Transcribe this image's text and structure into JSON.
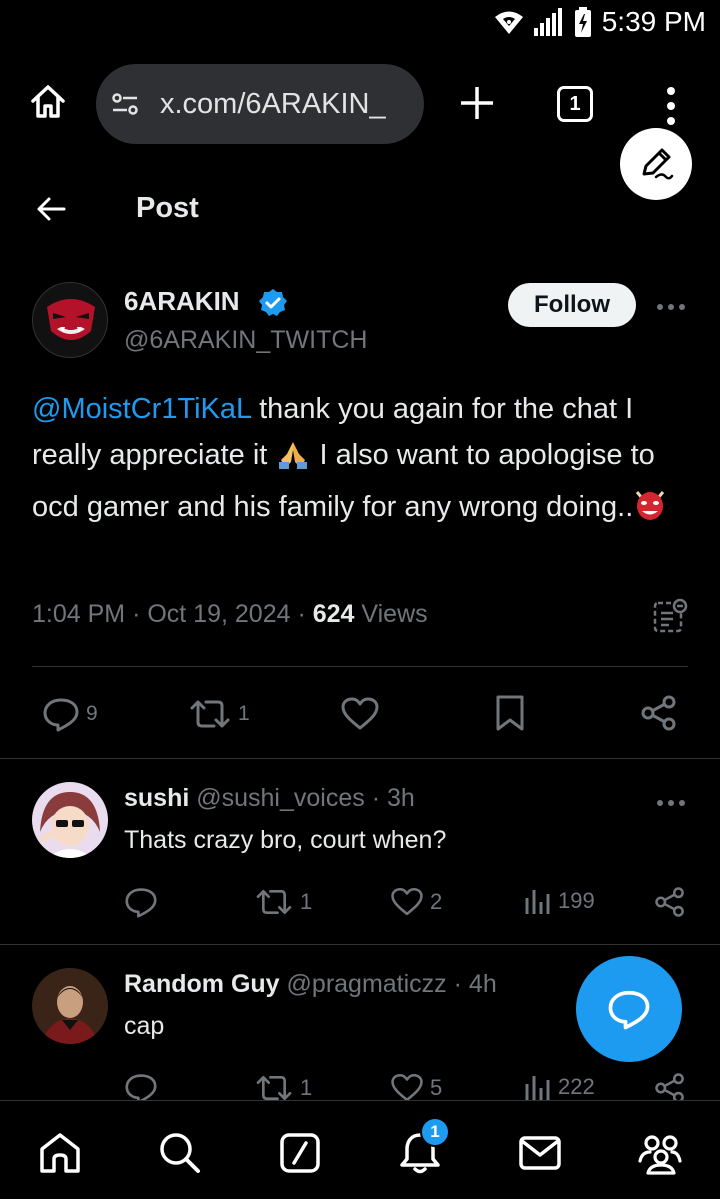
{
  "status_bar": {
    "time": "5:39 PM",
    "icons": [
      "wifi-icon",
      "signal-icon",
      "battery-charging-icon"
    ]
  },
  "browser": {
    "url": "x.com/6ARAKIN_",
    "tab_count": "1"
  },
  "header": {
    "title": "Post"
  },
  "post": {
    "author_name": "6ARAKIN",
    "author_handle": "@6ARAKIN_TWITCH",
    "verified": true,
    "follow_label": "Follow",
    "mention": "@MoistCr1TiKaL",
    "text_part1": " thank you again for the chat I really appreciate it ",
    "text_part2": "  I also want to apologise to ocd gamer and his family for any wrong doing..",
    "time": "1:04 PM",
    "date": "Oct 19, 2024",
    "views_count": "624",
    "views_label": "Views",
    "reply_count": "9",
    "repost_count": "1"
  },
  "replies": [
    {
      "name": "sushi",
      "handle": "@sushi_voices",
      "time": "3h",
      "text": "Thats crazy bro, court when?",
      "reposts": "1",
      "likes": "2",
      "views": "199"
    },
    {
      "name": "Random Guy",
      "handle": "@pragmaticzz",
      "time": "4h",
      "text": "cap",
      "reposts": "1",
      "likes": "5",
      "views": "222"
    }
  ],
  "bottom_nav": {
    "notification_badge": "1",
    "items": [
      "home-icon",
      "search-icon",
      "grok-icon",
      "notifications-icon",
      "messages-icon",
      "communities-icon"
    ]
  },
  "colors": {
    "accent": "#1d9bf0",
    "background": "#000000",
    "muted": "#71767b",
    "text": "#e7e9ea",
    "divider": "#2f3336"
  }
}
